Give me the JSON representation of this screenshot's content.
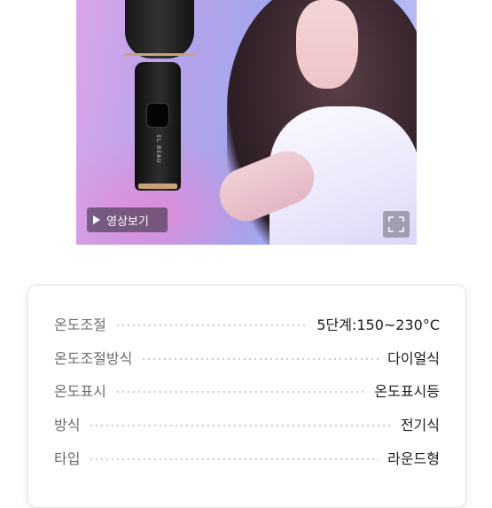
{
  "media": {
    "video_button_label": "영상보기",
    "device_logo_text": "EL BEAU"
  },
  "specs": {
    "rows": [
      {
        "label": "온도조절",
        "value": "5단계:150~230°C"
      },
      {
        "label": "온도조절방식",
        "value": "다이얼식"
      },
      {
        "label": "온도표시",
        "value": "온도표시등"
      },
      {
        "label": "방식",
        "value": "전기식"
      },
      {
        "label": "타입",
        "value": "라운드형"
      }
    ]
  },
  "icons": {
    "play": "play-icon",
    "expand": "expand-icon"
  }
}
